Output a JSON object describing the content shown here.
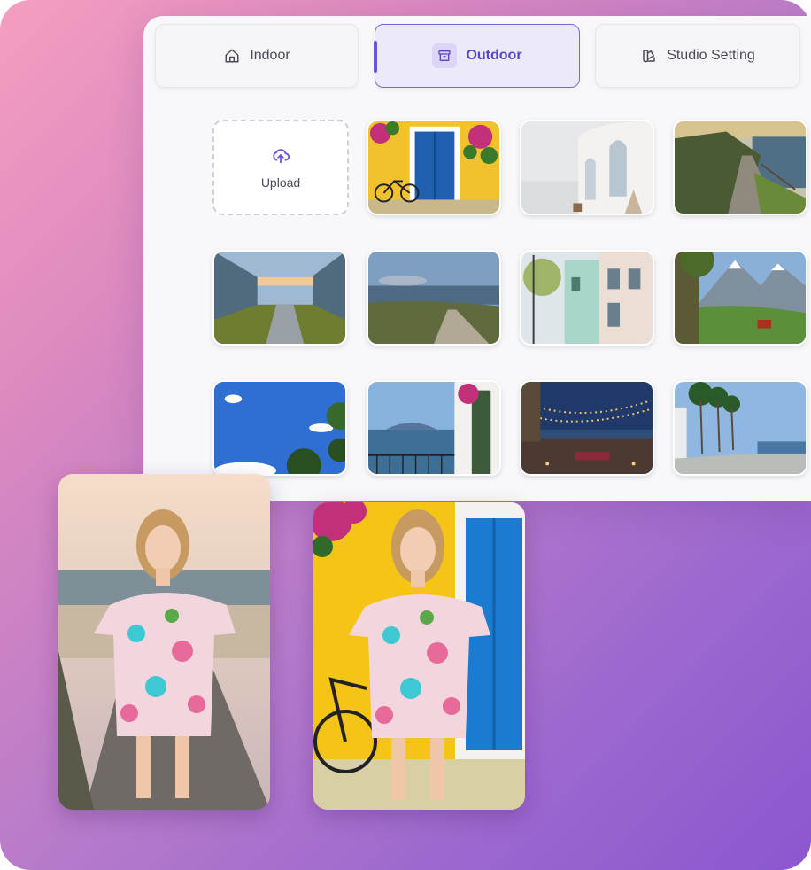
{
  "tabs": [
    {
      "label": "Indoor",
      "icon": "home-icon",
      "active": false
    },
    {
      "label": "Outdoor",
      "icon": "archive-icon",
      "active": true
    },
    {
      "label": "Studio Setting",
      "icon": "swatch-icon",
      "active": false
    }
  ],
  "upload": {
    "label": "Upload",
    "icon": "upload-cloud-icon"
  },
  "colors": {
    "accent": "#6b55d6",
    "accent_bg": "#ece9fb",
    "panel_bg": "#f8f8fb",
    "gradient_start": "#f59ec0",
    "gradient_end": "#8a57cf"
  },
  "scenes": [
    "scene-yellow-wall-blue-door",
    "scene-white-mediterranean-house",
    "scene-coastal-boardwalk",
    "scene-modern-office-walkway",
    "scene-beach-boardwalk-dunes",
    "scene-pastel-street",
    "scene-mountain-meadow",
    "scene-blue-sky-trees",
    "scene-sea-view-balcony",
    "scene-terrace-string-lights",
    "scene-palm-promenade"
  ],
  "previews": [
    "model-on-boardwalk",
    "model-on-yellow-wall"
  ]
}
